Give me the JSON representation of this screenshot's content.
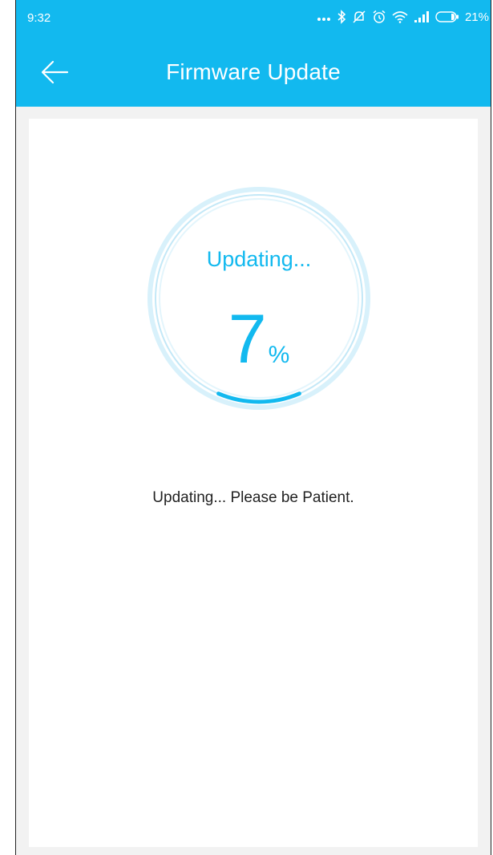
{
  "status_bar": {
    "time": "9:32",
    "battery_percent_text": "21%",
    "battery_level": 0.21,
    "icons": [
      "more-dots-icon",
      "bluetooth-icon",
      "notifications-off-icon",
      "alarm-icon",
      "wifi-icon",
      "signal-icon",
      "battery-icon"
    ]
  },
  "app_bar": {
    "title": "Firmware Update",
    "back_icon": "arrow-left-icon"
  },
  "progress": {
    "status_label": "Updating...",
    "value": "7",
    "unit": "%",
    "fraction": 0.07
  },
  "message": "Updating... Please be Patient.",
  "colors": {
    "accent": "#12b9ef",
    "background": "#f2f2f2",
    "card": "#ffffff",
    "text": "#222222"
  }
}
